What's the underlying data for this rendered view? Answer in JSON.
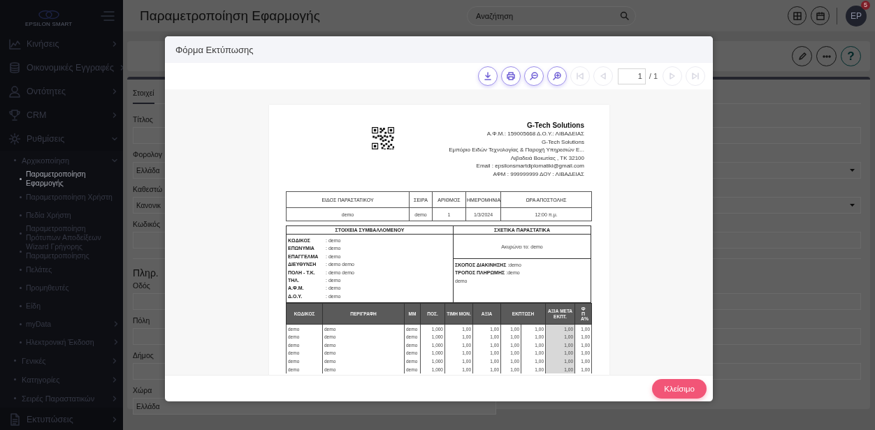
{
  "sidebar": {
    "logo": "EPSILON SMART",
    "items": [
      {
        "label": "Κινήσεις",
        "expanded": false
      },
      {
        "label": "Οικονομικές Εγγραφές",
        "expanded": false
      },
      {
        "label": "Οντότητες",
        "expanded": false
      },
      {
        "label": "CRM",
        "expanded": false
      },
      {
        "label": "Ρυθμίσεις",
        "expanded": true,
        "children": [
          {
            "label": "Αρχικοποίηση",
            "expanded": true,
            "children": [
              {
                "label": "Παραμετροποίηση Εφαρμογής",
                "selected": true
              },
              {
                "label": "Παραμετροποίηση Χρήστη",
                "selected": false
              },
              {
                "label": "Πεδία Χρήστη",
                "selected": false
              },
              {
                "label": "Παραμετροποίηση Πρότυπων Αποδείξεων",
                "selected": false
              },
              {
                "label": "Wizard Γρήγορης Παραμετροποίησης",
                "selected": false
              },
              {
                "label": "Πελάτες",
                "selected": false
              },
              {
                "label": "Προμηθευτές",
                "selected": false
              },
              {
                "label": "Είδη",
                "selected": false
              },
              {
                "label": "myData",
                "selected": false,
                "expanded": false
              },
              {
                "label": "Ηλεκτρονική Έκδοση",
                "selected": false,
                "expanded": false
              }
            ]
          },
          {
            "label": "Γενικές",
            "expanded": false
          },
          {
            "label": "Κατηγορίες",
            "expanded": false
          },
          {
            "label": "Σειρές Παραστατικών",
            "expanded": false
          }
        ]
      },
      {
        "label": "Εκτυπώσεις",
        "expanded": false
      }
    ]
  },
  "header": {
    "title": "Παραμετροποίηση Εφαρμογής",
    "search": {
      "placeholder": "Αναζήτηση"
    },
    "avatar": {
      "initials": "EP",
      "badge": "5"
    }
  },
  "toolbar": {
    "help": "?"
  },
  "form": {
    "tabs": [
      {
        "label": "Στοιχεί",
        "selected": true
      }
    ],
    "fields": [
      {
        "label": "Τίτλος",
        "kind": "text"
      },
      {
        "label": "Φορολογ",
        "kind": "select",
        "value": "Ελλάδα"
      },
      {
        "label": "Καθεστώ",
        "kind": "select",
        "value": "Κανονικ"
      },
      {
        "label": "Κωδικός",
        "kind": "text"
      }
    ],
    "section": "Πληρ.",
    "address_fields": [
      {
        "label": "Οδός",
        "kind": "text"
      },
      {
        "label": "Πόλη",
        "kind": "text"
      },
      {
        "label": "Δήμος",
        "kind": "text"
      },
      {
        "label": "Χώρα",
        "kind": "short",
        "value": "Ελλάδα"
      }
    ]
  },
  "modal": {
    "title": "Φόρμα Εκτύπωσης",
    "buttons": [
      {
        "kind": "download",
        "disabled": false
      },
      {
        "kind": "print",
        "disabled": false
      },
      {
        "kind": "zoom-out",
        "disabled": false
      },
      {
        "kind": "zoom-in",
        "disabled": false
      },
      {
        "kind": "first",
        "disabled": true
      },
      {
        "kind": "previous",
        "disabled": true
      }
    ],
    "page": {
      "value": "1",
      "total": "/ 1"
    },
    "nav_buttons": [
      {
        "kind": "next",
        "disabled": true
      },
      {
        "kind": "last",
        "disabled": true
      }
    ],
    "document": {
      "company": {
        "name": "G-Tech Solutions",
        "lines": [
          "Α.Φ.Μ.: 159005668 Δ.Ο.Υ.: ΛΙΒΑΔΕΙΑΣ",
          "G-Tech Solutions",
          "Εμπόριο Ειδών Τεχνολογίας & Παροχή Υπηρεσιών Ε...",
          "Λιβαδειά Βοιωτίας , ΤΚ 32100",
          "Email : epsilonsmartdiplomatiki@gmail.com",
          "ΑΦΜ : 999999999 ΔΟΥ : ΛΙΒΑΔΕΙΑΣ"
        ]
      },
      "info_table": {
        "columns": [
          "ΕΙΔΟΣ ΠΑΡΑΣΤΑΤΙΚΟΥ",
          "ΣΕΙΡΑ",
          "ΑΡΙΘΜΟΣ",
          "ΗΜΕΡΟΜΗΝΙΑ",
          "ΩΡΑ ΑΠΟΣΤΟΛΗΣ"
        ],
        "row": [
          "demo",
          "demo",
          "1",
          "1/3/2024",
          "12:00 π.μ."
        ]
      },
      "party": {
        "title": "ΣΤΟΙΧΕΙΑ ΣΥΜΒΑΛΛΟΜΕΝΟΥ",
        "rows": [
          {
            "label": "ΚΩΔΙΚΟΣ",
            "value": ": demo"
          },
          {
            "label": "ΕΠΩΝΥΜΙΑ",
            "value": ": demo"
          },
          {
            "label": "ΕΠΑΓΓΕΛΜΑ",
            "value": ": demo"
          },
          {
            "label": "ΔΙΕΥΘΥΝΣΗ",
            "value": ": demo demo"
          },
          {
            "label": "ΠΟΛΗ - Τ.Κ.",
            "value": ": demo demo"
          },
          {
            "label": "ΤΗΛ.",
            "value": ": demo"
          },
          {
            "label": "Α.Φ.Μ.",
            "value": ": demo"
          },
          {
            "label": "Δ.Ο.Υ.",
            "value": ": demo"
          }
        ]
      },
      "related": {
        "title": "ΣΧΕΤΙΚΑ ΠΑΡΑΣΤΑΤΙΚΑ",
        "cancels": "Ακυρώνει το: demo",
        "rows": [
          {
            "label": "ΣΚΟΠΟΣ ΔΙΑΚΙΝΗΣΗΣ",
            "value": ":demo"
          },
          {
            "label": "ΤΡΟΠΟΣ ΠΛΗΡΩΜΗΣ",
            "value": ":demo"
          }
        ],
        "note": "demo"
      },
      "items": {
        "columns": [
          {
            "label": "ΚΩΔΙΚΟΣ",
            "kind": "single",
            "highlighted": false
          },
          {
            "label": "ΠΕΡΙΓΡΑΦΗ",
            "kind": "single",
            "highlighted": false
          },
          {
            "label": "ΜΜ",
            "kind": "single",
            "highlighted": false
          },
          {
            "label": "ΠΟΣ.",
            "kind": "single",
            "highlighted": false
          },
          {
            "label": "ΤΙΜΗ ΜΟΝ.",
            "kind": "single",
            "highlighted": false
          },
          {
            "label": "ΑΞΙΑ",
            "kind": "single",
            "highlighted": false
          },
          {
            "label": "ΕΚΠΤΩΣΗ",
            "kind": "single",
            "colspan": 2,
            "highlighted": false
          },
          {
            "label": "ΑΞΙΑ ΜΕΤΑ ΕΚΠΤ.",
            "kind": "single",
            "highlighted": true
          },
          {
            "label": "ΦΠΑ%",
            "kind": "vertical",
            "highlighted": false
          }
        ],
        "rows": [
          [
            "demo",
            "demo",
            "demo",
            "1,000",
            "1,00",
            "1,00",
            "1,00",
            "1,00",
            "1,00",
            "1,00"
          ],
          [
            "demo",
            "demo",
            "demo",
            "1,000",
            "1,00",
            "1,00",
            "1,00",
            "1,00",
            "1,00",
            "1,00"
          ],
          [
            "demo",
            "demo",
            "demo",
            "1,000",
            "1,00",
            "1,00",
            "1,00",
            "1,00",
            "1,00",
            "1,00"
          ],
          [
            "demo",
            "demo",
            "demo",
            "1,000",
            "1,00",
            "1,00",
            "1,00",
            "1,00",
            "1,00",
            "1,00"
          ],
          [
            "demo",
            "demo",
            "demo",
            "1,000",
            "1,00",
            "1,00",
            "1,00",
            "1,00",
            "1,00",
            "1,00"
          ],
          [
            "demo",
            "demo",
            "demo",
            "1,000",
            "1,00",
            "1,00",
            "1,00",
            "1,00",
            "1,00",
            "1,00"
          ]
        ]
      }
    },
    "close": "Κλείσιμο"
  }
}
